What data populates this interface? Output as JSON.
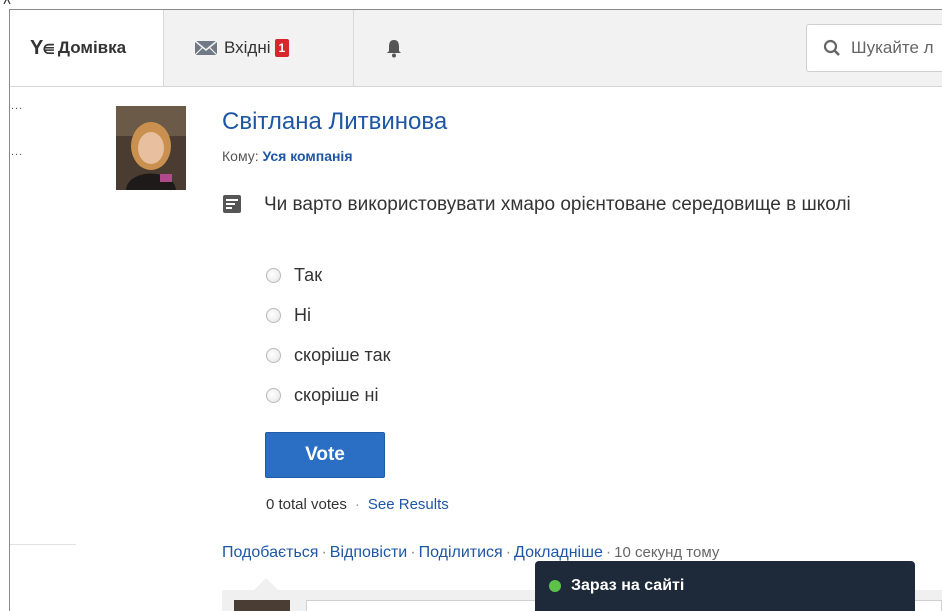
{
  "nav": {
    "home_label": "Домівка",
    "inbox_label": "Вхідні",
    "inbox_badge": "1",
    "search_placeholder": "Шукайте л"
  },
  "left": {
    "frag1": "...",
    "frag2": "..."
  },
  "post": {
    "author": "Світлана Литвинова",
    "to_prefix": "Кому:",
    "to_target": "Уся компанія",
    "question": "Чи варто використовувати хмаро орієнтоване середовище в школі",
    "options": [
      "Так",
      "Ні",
      "скоріше так",
      "скоріше ні"
    ],
    "vote_label": "Vote",
    "total_votes": "0 total votes",
    "see_results": "See Results",
    "actions": {
      "like": "Подобається",
      "reply": "Відповісти",
      "share": "Поділитися",
      "more": "Докладніше",
      "time": "10 секунд тому"
    }
  },
  "online": {
    "label": "Зараз на сайті",
    "status_color": "#5cc24a"
  },
  "colors": {
    "link": "#1e56a4",
    "button": "#2b6fc4",
    "badge": "#d7262c"
  }
}
